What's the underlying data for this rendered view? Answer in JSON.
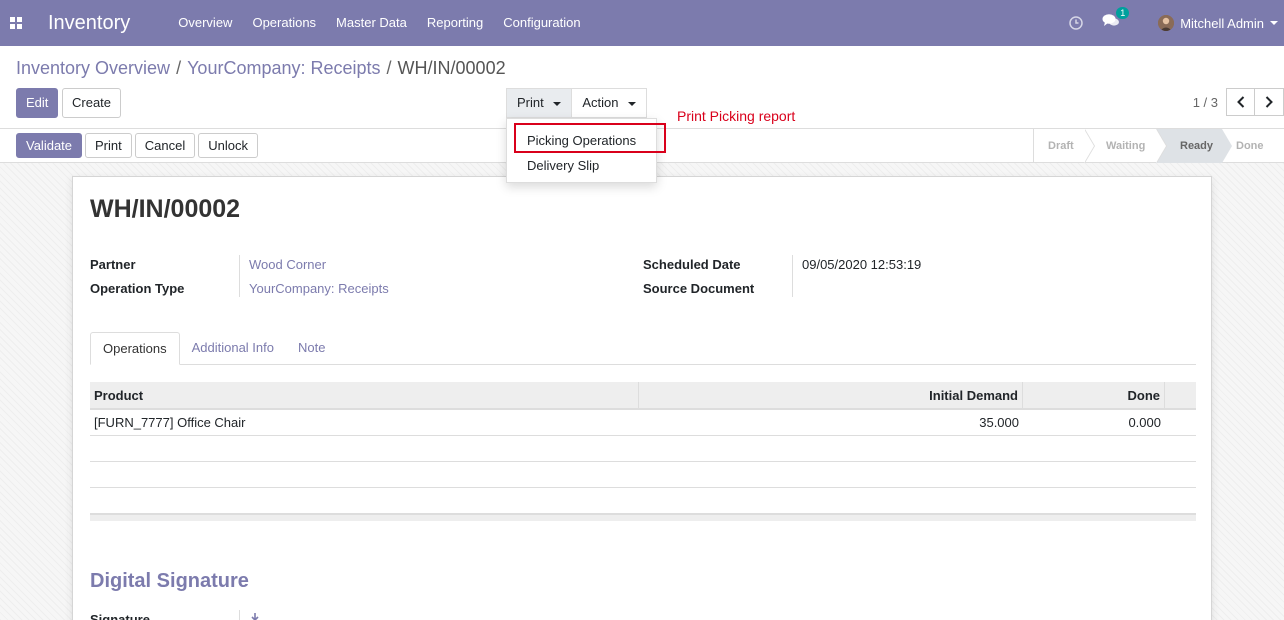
{
  "navbar": {
    "app_title": "Inventory",
    "menu": [
      "Overview",
      "Operations",
      "Master Data",
      "Reporting",
      "Configuration"
    ],
    "chat_count": "1",
    "user_name": "Mitchell Admin"
  },
  "breadcrumb": {
    "items": [
      "Inventory Overview",
      "YourCompany: Receipts"
    ],
    "current": "WH/IN/00002"
  },
  "control_panel": {
    "edit_label": "Edit",
    "create_label": "Create",
    "print_label": "Print",
    "action_label": "Action",
    "pager_value": "1 / 3"
  },
  "statusbar": {
    "buttons": [
      "Validate",
      "Print",
      "Cancel",
      "Unlock"
    ],
    "stages": [
      "Draft",
      "Waiting",
      "Ready",
      "Done"
    ],
    "active_stage": "Ready"
  },
  "print_dropdown": {
    "items": [
      "Picking Operations",
      "Delivery Slip"
    ]
  },
  "annotation": "Print Picking report",
  "record": {
    "name": "WH/IN/00002",
    "fields": {
      "partner_label": "Partner",
      "partner_value": "Wood Corner",
      "operation_type_label": "Operation Type",
      "operation_type_value": "YourCompany: Receipts",
      "scheduled_date_label": "Scheduled Date",
      "scheduled_date_value": "09/05/2020 12:53:19",
      "source_document_label": "Source Document"
    },
    "tabs": [
      "Operations",
      "Additional Info",
      "Note"
    ],
    "table": {
      "headers": [
        "Product",
        "Initial Demand",
        "Done"
      ],
      "rows": [
        {
          "product": "[FURN_7777] Office Chair",
          "initial_demand": "35.000",
          "done": "0.000"
        }
      ]
    },
    "signature_section_title": "Digital Signature",
    "signature_label": "Signature"
  },
  "colors": {
    "brand": "#7c7bad",
    "annotation": "#d9001b"
  }
}
